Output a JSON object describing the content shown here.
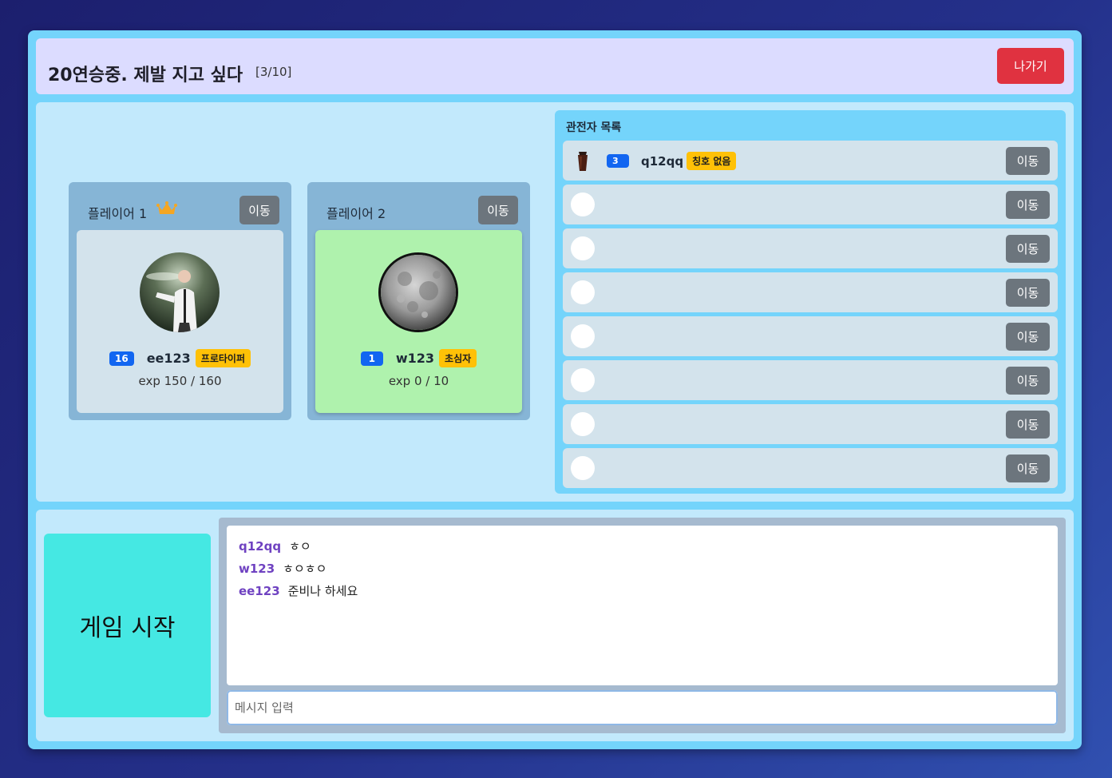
{
  "header": {
    "room_title": "20연승중. 제발 지고 싶다",
    "room_count": "[3/10]",
    "exit_label": "나가기"
  },
  "players": [
    {
      "label": "플레이어 1",
      "is_host": true,
      "move_label": "이동",
      "level": "16",
      "name": "ee123",
      "title": "프로타이퍼",
      "exp": "exp 150 / 160",
      "ready": false
    },
    {
      "label": "플레이어 2",
      "is_host": false,
      "move_label": "이동",
      "level": "1",
      "name": "w123",
      "title": "초심자",
      "exp": "exp 0 / 10",
      "ready": true
    }
  ],
  "spectators": {
    "title": "관전자 목록",
    "move_label": "이동",
    "rows": [
      {
        "occupied": true,
        "avatar_icon": "drink-cup-icon",
        "level": "3",
        "name": "q12qq",
        "title": "칭호 없음"
      },
      {
        "occupied": false
      },
      {
        "occupied": false
      },
      {
        "occupied": false
      },
      {
        "occupied": false
      },
      {
        "occupied": false
      },
      {
        "occupied": false
      },
      {
        "occupied": false
      }
    ]
  },
  "start_button": "게임 시작",
  "chat": {
    "messages": [
      {
        "user": "q12qq",
        "text": "ㅎㅇ"
      },
      {
        "user": "w123",
        "text": "ㅎㅇㅎㅇ"
      },
      {
        "user": "ee123",
        "text": "준비나 하세요"
      }
    ],
    "input_placeholder": "메시지 입력"
  },
  "colors": {
    "exit": "#e03240",
    "start": "#45e8e3",
    "level_badge": "#1266f1",
    "title_badge": "#ffc107",
    "chat_user": "#6f42c1",
    "ready_bg": "#aff2ad"
  }
}
